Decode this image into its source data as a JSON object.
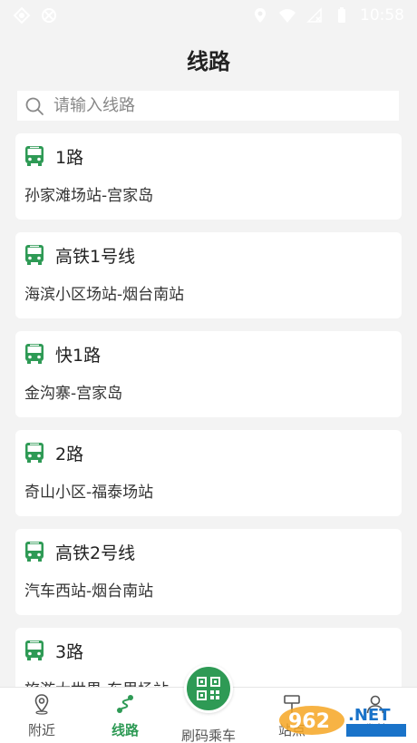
{
  "status_bar": {
    "time": "10:58",
    "left_icons": [
      "notification-icon",
      "app-icon"
    ],
    "right_icons": [
      "location-icon",
      "wifi-icon",
      "no-sim-icon",
      "battery-icon"
    ]
  },
  "header": {
    "title": "线路"
  },
  "search": {
    "placeholder": "请输入线路",
    "value": ""
  },
  "routes": [
    {
      "name": "1路",
      "stops": "孙家滩场站-宫家岛"
    },
    {
      "name": "高铁1号线",
      "stops": "海滨小区场站-烟台南站"
    },
    {
      "name": "快1路",
      "stops": "金沟寨-宫家岛"
    },
    {
      "name": "2路",
      "stops": "奇山小区-福泰场站"
    },
    {
      "name": "高铁2号线",
      "stops": "汽车西站-烟台南站"
    },
    {
      "name": "3路",
      "stops": "旅游大世界-东里场站"
    }
  ],
  "bottom_nav": {
    "nearby": "附近",
    "routes": "线路",
    "scan": "刷码乘车",
    "stations": "站点",
    "mine": "我的"
  },
  "colors": {
    "accent": "#2e9a55",
    "status_bar": "#ffffff",
    "background": "#f3f3f3",
    "card": "#ffffff"
  }
}
